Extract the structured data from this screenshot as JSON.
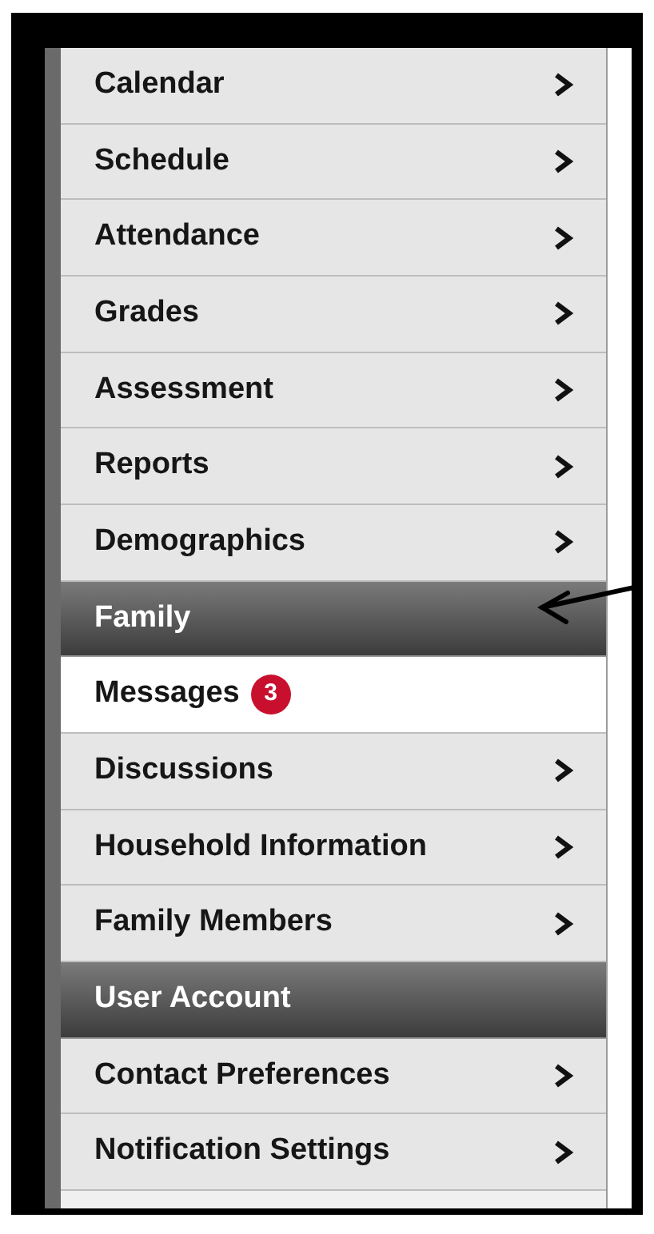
{
  "menu": [
    {
      "kind": "link",
      "label": "Calendar",
      "selected": false
    },
    {
      "kind": "link",
      "label": "Schedule",
      "selected": false
    },
    {
      "kind": "link",
      "label": "Attendance",
      "selected": false
    },
    {
      "kind": "link",
      "label": "Grades",
      "selected": false
    },
    {
      "kind": "link",
      "label": "Assessment",
      "selected": false
    },
    {
      "kind": "link",
      "label": "Reports",
      "selected": false
    },
    {
      "kind": "link",
      "label": "Demographics",
      "selected": false
    },
    {
      "kind": "header",
      "label": "Family"
    },
    {
      "kind": "plain",
      "label": "Messages",
      "badge": "3",
      "selected": true
    },
    {
      "kind": "link",
      "label": "Discussions",
      "selected": false
    },
    {
      "kind": "link",
      "label": "Household Information",
      "selected": false
    },
    {
      "kind": "link",
      "label": "Family Members",
      "selected": false
    },
    {
      "kind": "header",
      "label": "User Account"
    },
    {
      "kind": "link",
      "label": "Contact Preferences",
      "selected": false
    },
    {
      "kind": "link",
      "label": "Notification Settings",
      "selected": false
    }
  ]
}
